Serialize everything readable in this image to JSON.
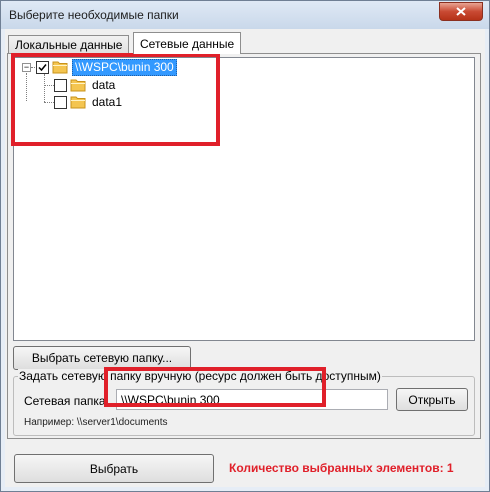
{
  "window": {
    "title": "Выберите необходимые папки"
  },
  "tabs": [
    {
      "label": "Локальные данные",
      "active": false
    },
    {
      "label": "Сетевые данные",
      "active": true
    }
  ],
  "tree": {
    "root": {
      "label": "\\\\WSPC\\bunin 300",
      "checked": true,
      "expanded": true,
      "selected": true
    },
    "children": [
      {
        "label": "data",
        "checked": false
      },
      {
        "label": "data1",
        "checked": false
      }
    ]
  },
  "buttons": {
    "select_network_folder": "Выбрать сетевую папку...",
    "open": "Открыть",
    "select": "Выбрать"
  },
  "manual": {
    "legend": "Задать сетевую папку вручную (ресурс должен быть доступным)",
    "field_label": "Сетевая папка",
    "value": "\\\\WSPC\\bunin 300",
    "example": "Например: \\\\server1\\documents"
  },
  "status": {
    "selected_count": "Количество выбранных элементов: 1"
  },
  "colors": {
    "highlight_red": "#e0202a",
    "selection_blue": "#3399ff"
  },
  "icons": {
    "close": "close-icon",
    "folder": "folder-icon",
    "check": "check-icon"
  }
}
